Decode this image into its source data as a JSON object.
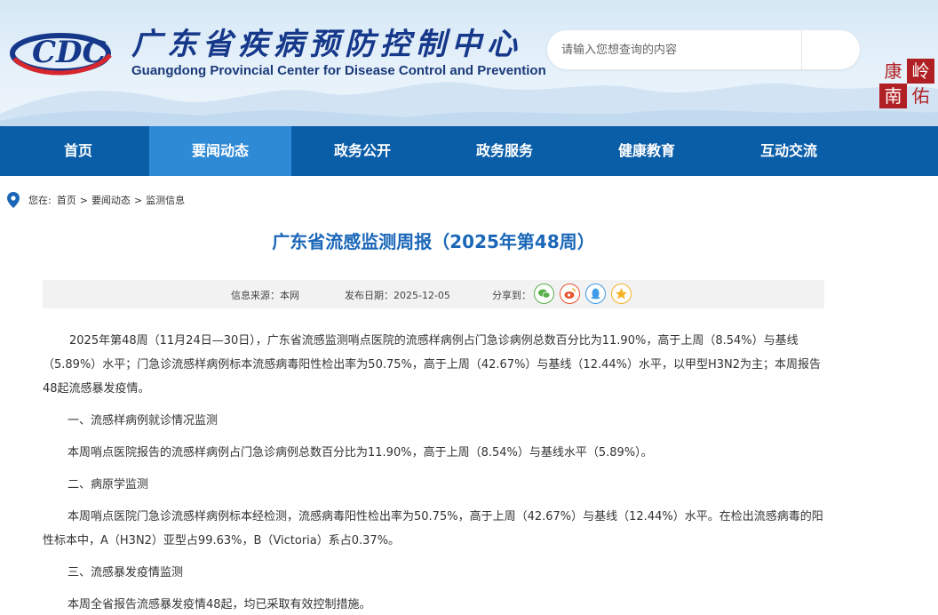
{
  "header": {
    "cn_title": "广东省疾病预防控制中心",
    "en_title": "Guangdong Provincial Center for Disease Control and Prevention",
    "logo_text": "CDC",
    "search_placeholder": "请输入您想查询的内容",
    "stamp_chars": [
      "康",
      "岭",
      "南",
      "佑"
    ]
  },
  "nav": {
    "items": [
      "首页",
      "要闻动态",
      "政务公开",
      "政务服务",
      "健康教育",
      "互动交流"
    ],
    "active_index": 1
  },
  "breadcrumb": {
    "prefix": "您在:",
    "items": [
      "首页",
      "要闻动态",
      "监测信息"
    ],
    "separator": ">"
  },
  "article": {
    "title": "广东省流感监测周报（2025年第48周）",
    "source": "信息来源：本网",
    "date": "发布日期：2025-12-05",
    "share_label": "分享到：",
    "share_icons": [
      "wechat-icon",
      "weibo-icon",
      "qq-icon",
      "qzone-icon"
    ],
    "paragraphs": [
      {
        "type": "lead",
        "text": "2025年第48周（11月24日—30日），广东省流感监测哨点医院的流感样病例占门急诊病例总数百分比为11.90%，高于上周（8.54%）与基线（5.89%）水平；门急诊流感样病例标本流感病毒阳性检出率为50.75%，高于上周（42.67%）与基线（12.44%）水平，以甲型H3N2为主；本周报告48起流感暴发疫情。"
      },
      {
        "type": "sub",
        "text": "一、流感样病例就诊情况监测"
      },
      {
        "type": "body",
        "text": "本周哨点医院报告的流感样病例占门急诊病例总数百分比为11.90%，高于上周（8.54%）与基线水平（5.89%）。"
      },
      {
        "type": "sub",
        "text": "二、病原学监测"
      },
      {
        "type": "body",
        "text": "本周哨点医院门急诊流感样病例标本经检测，流感病毒阳性检出率为50.75%，高于上周（42.67%）与基线（12.44%）水平。在检出流感病毒的阳性标本中，A（H3N2）亚型占99.63%，B（Victoria）系占0.37%。"
      },
      {
        "type": "sub",
        "text": "三、流感暴发疫情监测"
      },
      {
        "type": "body",
        "text": "本周全省报告流感暴发疫情48起，均已采取有效控制措施。"
      }
    ]
  },
  "colors": {
    "nav_bg": "#0a5ea8",
    "nav_active": "#2f8ad6",
    "title": "#1a67b8",
    "brand_dark": "#16388a",
    "stamp_red": "#b01f24"
  }
}
